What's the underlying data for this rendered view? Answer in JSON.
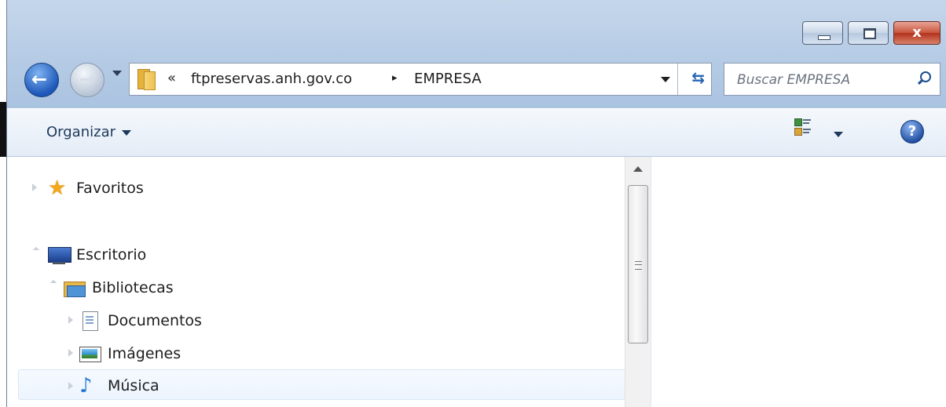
{
  "window": {
    "caption_buttons": {
      "minimize": "minimize",
      "maximize": "maximize",
      "close": "x"
    }
  },
  "navigation": {
    "back_icon": "back-arrow",
    "forward_icon": "forward-arrow",
    "address": {
      "overflow_chevron": "«",
      "crumbs": [
        "ftpreservas.anh.gov.co",
        "EMPRESA"
      ],
      "separator": "▸"
    },
    "refresh_icon": "refresh"
  },
  "search": {
    "placeholder": "Buscar EMPRESA"
  },
  "toolbar": {
    "organize_label": "Organizar",
    "help_label": "?"
  },
  "tree": {
    "items": [
      {
        "label": "Favoritos",
        "icon": "star-icon"
      },
      {
        "label": "Escritorio",
        "icon": "desktop-icon"
      },
      {
        "label": "Bibliotecas",
        "icon": "libraries-icon"
      },
      {
        "label": "Documentos",
        "icon": "document-icon"
      },
      {
        "label": "Imágenes",
        "icon": "image-icon"
      },
      {
        "label": "Música",
        "icon": "music-icon",
        "selected": true
      }
    ]
  },
  "colors": {
    "title_gradient_top": "#c4d6ea",
    "toolbar_top": "#f4f8fc",
    "text": "#1e1e1e"
  }
}
